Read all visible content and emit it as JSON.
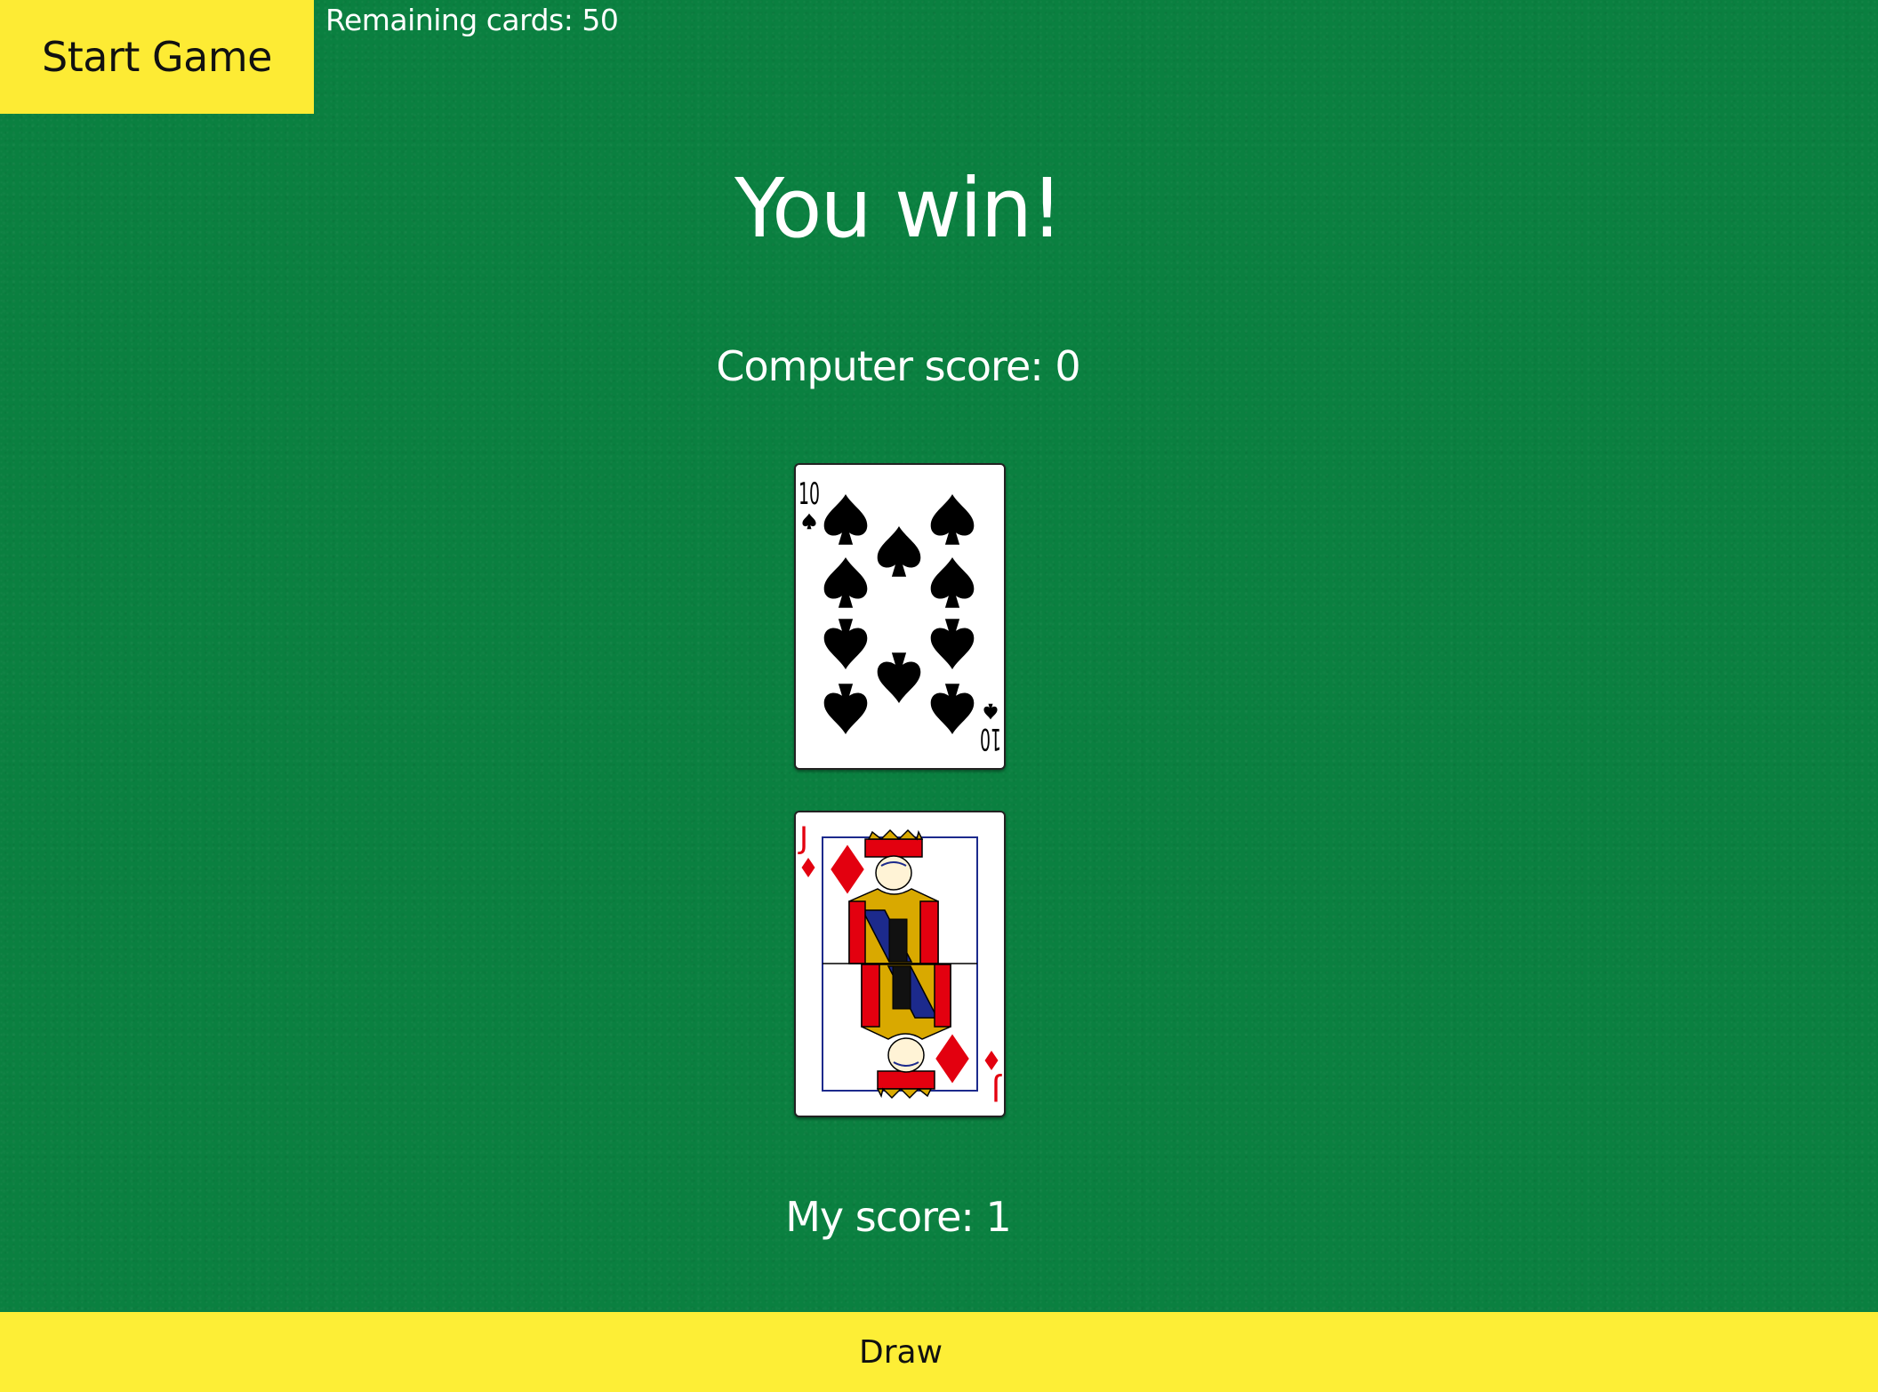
{
  "controls": {
    "start_label": "Start Game",
    "draw_label": "Draw"
  },
  "status": {
    "remaining_cards": "Remaining cards: 50",
    "result": "You win!",
    "computer_score": "Computer score: 0",
    "my_score": "My score: 1"
  },
  "cards": {
    "computer": {
      "rank": "10",
      "suit": "spades",
      "corner": "10"
    },
    "player": {
      "rank": "J",
      "suit": "diamonds",
      "corner": "J"
    }
  },
  "colors": {
    "table_felt": "#0a8040",
    "button_yellow": "#fdeb34",
    "spade": "#000000",
    "diamond": "#e3000f"
  }
}
